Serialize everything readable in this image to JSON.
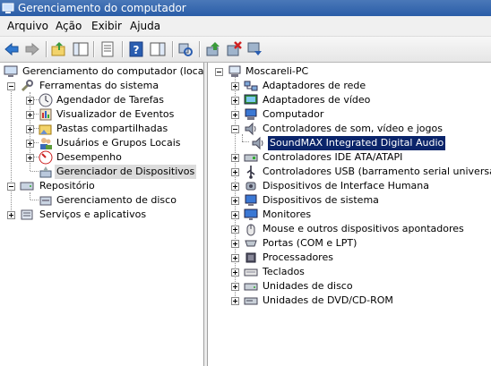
{
  "window": {
    "title": "Gerenciamento do computador"
  },
  "menu": {
    "arquivo": "Arquivo",
    "acao": "Ação",
    "exibir": "Exibir",
    "ajuda": "Ajuda"
  },
  "left_tree": {
    "root": "Gerenciamento do computador (local)",
    "ferramentas": "Ferramentas do sistema",
    "agendador": "Agendador de Tarefas",
    "visualizador": "Visualizador de Eventos",
    "pastas": "Pastas compartilhadas",
    "usuarios": "Usuários e Grupos Locais",
    "desempenho": "Desempenho",
    "gerenciador_dispositivos": "Gerenciador de Dispositivos",
    "repositorio": "Repositório",
    "gerenciamento_disco": "Gerenciamento de disco",
    "servicos": "Serviços e aplicativos"
  },
  "device_tree": {
    "computer": "Moscareli-PC",
    "items": [
      "Adaptadores de rede",
      "Adaptadores de vídeo",
      "Computador",
      "Controladores de som, vídeo e jogos",
      "SoundMAX Integrated Digital Audio",
      "Controladores IDE ATA/ATAPI",
      "Controladores USB (barramento serial universal)",
      "Dispositivos de Interface Humana",
      "Dispositivos de sistema",
      "Monitores",
      "Mouse e outros dispositivos apontadores",
      "Portas (COM e LPT)",
      "Processadores",
      "Teclados",
      "Unidades de disco",
      "Unidades de DVD/CD-ROM"
    ]
  },
  "colors": {
    "title_bar": "#2a5da8",
    "selection_blue": "#0a246a",
    "selection_gray": "#dcdcdc"
  }
}
